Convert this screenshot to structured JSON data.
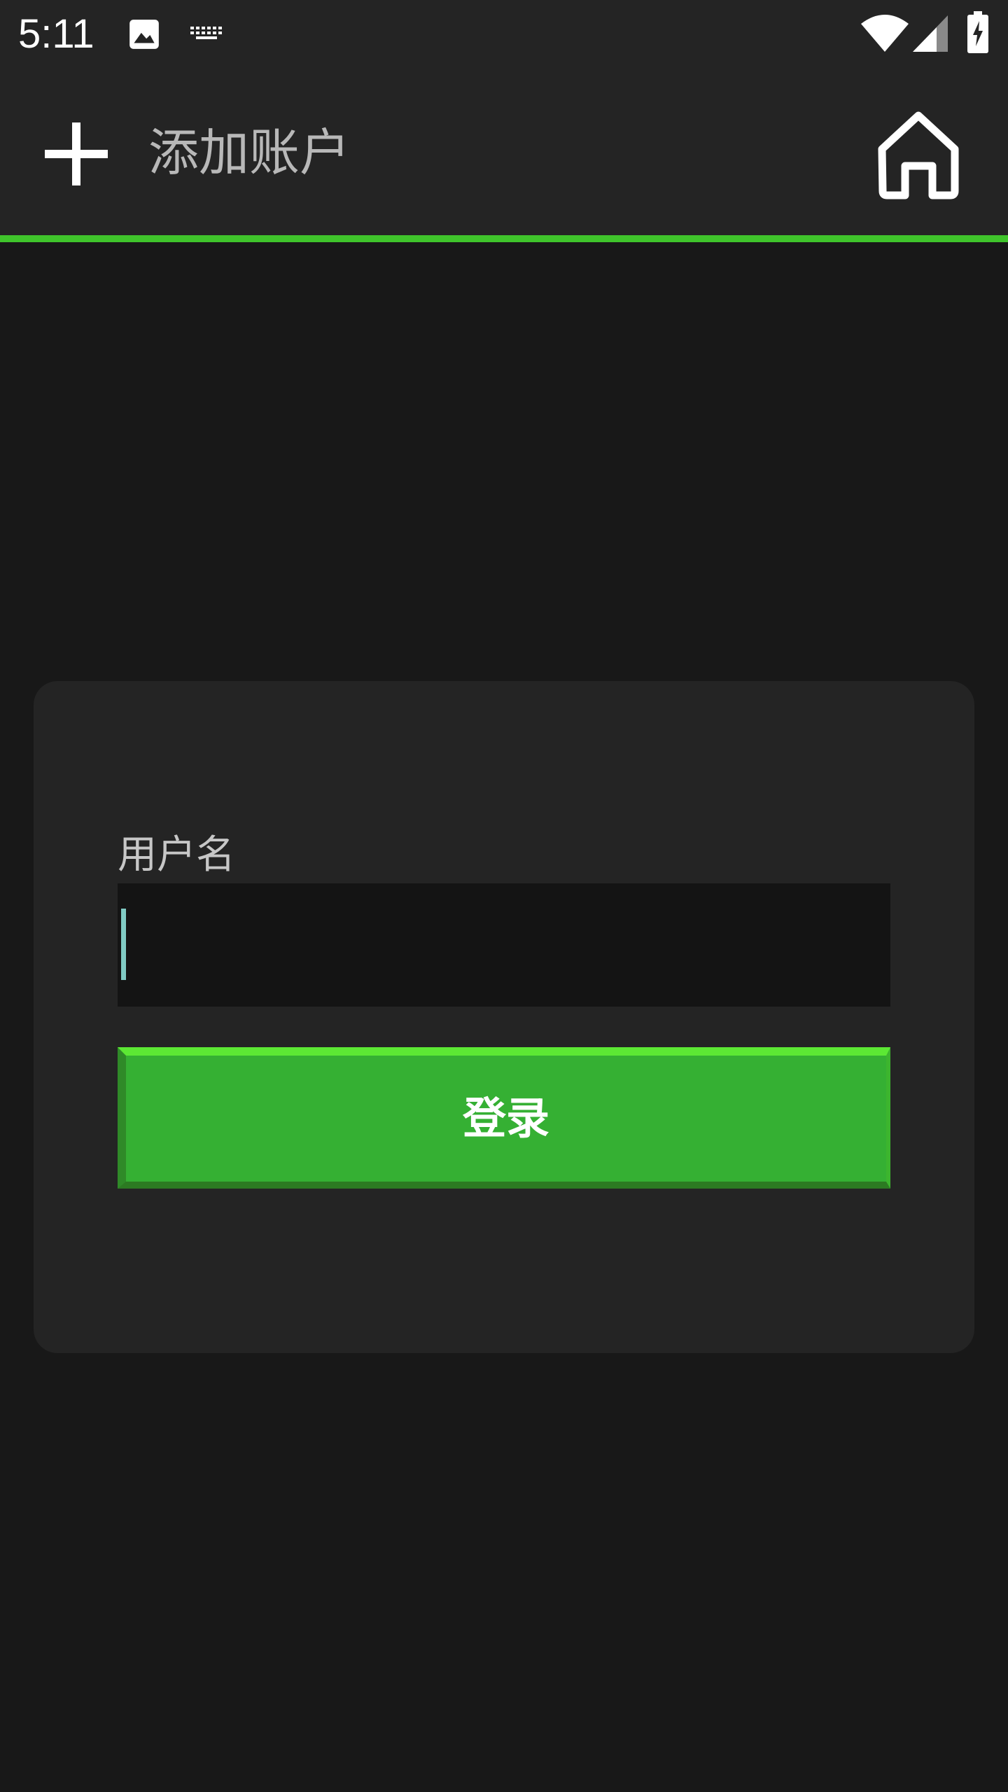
{
  "status_bar": {
    "time": "5:11",
    "icons": [
      "image-icon",
      "keyboard-icon",
      "wifi-icon",
      "signal-icon",
      "battery-charging-icon"
    ]
  },
  "app_bar": {
    "title": "添加账户",
    "leading_icon": "add-icon",
    "trailing_icon": "home-icon",
    "accent_color": "#3fc42b"
  },
  "form": {
    "username_label": "用户名",
    "username_value": "",
    "login_label": "登录"
  },
  "colors": {
    "background": "#181818",
    "surface": "#242424",
    "input_bg": "#141414",
    "button": "#35b033",
    "cursor": "#80cbc4"
  }
}
